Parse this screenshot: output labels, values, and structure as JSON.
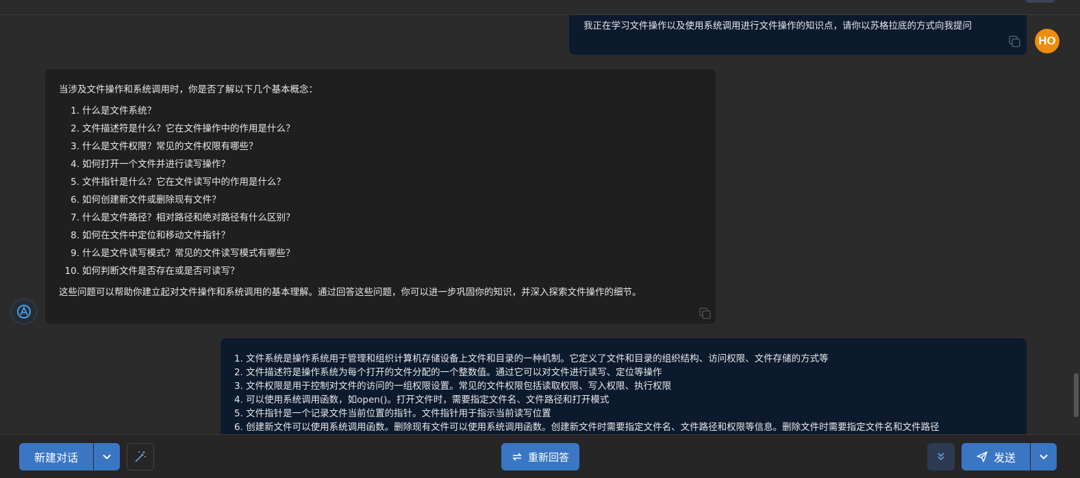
{
  "messages": {
    "user_question": "我正在学习文件操作以及使用系统调用进行文件操作的知识点，请你以苏格拉底的方式向我提问",
    "user_avatar_text": "HO",
    "bot_intro": "当涉及文件操作和系统调用时，你是否了解以下几个基本概念：",
    "bot_items": [
      {
        "num": "1.",
        "text": "什么是文件系统？"
      },
      {
        "num": "2.",
        "text": "文件描述符是什么？它在文件操作中的作用是什么？"
      },
      {
        "num": "3.",
        "text": "什么是文件权限？常见的文件权限有哪些？"
      },
      {
        "num": "4.",
        "text": "如何打开一个文件并进行读写操作？"
      },
      {
        "num": "5.",
        "text": "文件指针是什么？它在文件读写中的作用是什么？"
      },
      {
        "num": "6.",
        "text": "如何创建新文件或删除现有文件？"
      },
      {
        "num": "7.",
        "text": "什么是文件路径？相对路径和绝对路径有什么区别？"
      },
      {
        "num": "8.",
        "text": "如何在文件中定位和移动文件指针？"
      },
      {
        "num": "9.",
        "text": "什么是文件读写模式？常见的文件读写模式有哪些？"
      },
      {
        "num": "10.",
        "text": "如何判断文件是否存在或是否可读写？"
      }
    ],
    "bot_outro": "这些问题可以帮助你建立起对文件操作和系统调用的基本理解。通过回答这些问题，你可以进一步巩固你的知识，并深入探索文件操作的细节。",
    "user_answers": [
      "1. 文件系统是操作系统用于管理和组织计算机存储设备上文件和目录的一种机制。它定义了文件和目录的组织结构、访问权限、文件存储的方式等",
      "2. 文件描述符是操作系统为每个打开的文件分配的一个整数值。通过它可以对文件进行读写、定位等操作",
      "3. 文件权限是用于控制对文件的访问的一组权限设置。常见的文件权限包括读取权限、写入权限、执行权限",
      "4. 可以使用系统调用函数，如open()。打开文件时，需要指定文件名、文件路径和打开模式",
      "5. 文件指针是一个记录文件当前位置的指针。文件指针用于指示当前读写位置",
      "6. 创建新文件可以使用系统调用函数。删除现有文件可以使用系统调用函数。创建新文件时需要指定文件名、文件路径和权限等信息。删除文件时需要指定文件名和文件路径"
    ]
  },
  "toolbar": {
    "new_chat_label": "新建对话",
    "regenerate_label": "重新回答",
    "send_label": "发送"
  },
  "colors": {
    "accent": "#3a76c4",
    "user_bubble": "#0c1a2e",
    "bot_bubble": "#1f1f1f",
    "avatar_user": "#f08c0a"
  }
}
